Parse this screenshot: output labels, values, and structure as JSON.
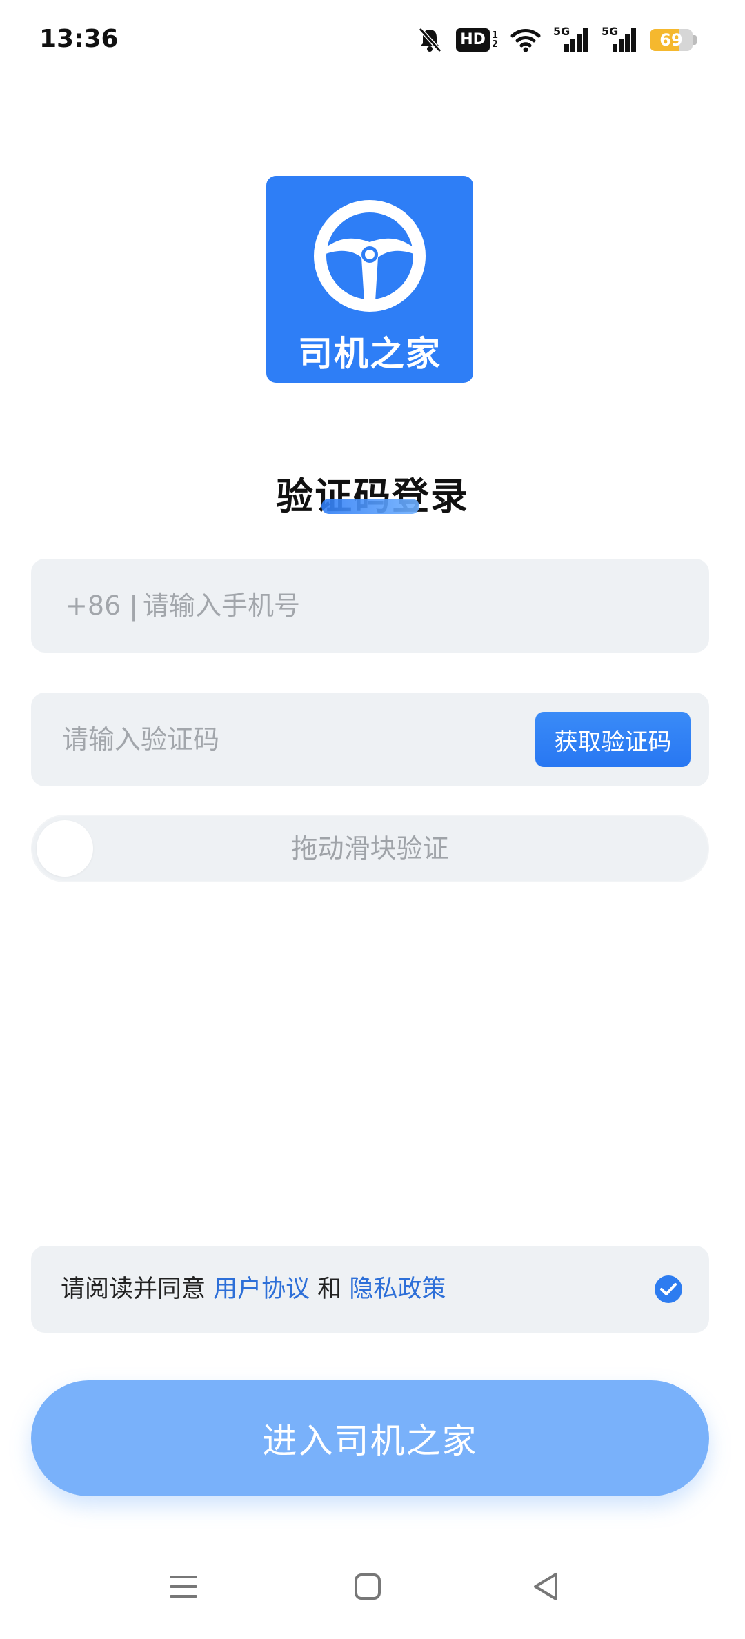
{
  "status_bar": {
    "time": "13:36",
    "hd_label": "HD",
    "hd_sub_1": "1",
    "hd_sub_2": "2",
    "signal_1_label": "5G",
    "signal_2_label": "5G",
    "battery_level": "69",
    "battery_fraction": 0.69,
    "battery_color": "#f5b82e",
    "icons": [
      "bell-muted-icon",
      "hd-icon",
      "wifi-icon",
      "signal-icon",
      "signal-icon",
      "battery-icon"
    ]
  },
  "app": {
    "logo_icon": "steering-wheel-icon",
    "logo_text": "司机之家",
    "brand_color": "#2e7ef6"
  },
  "login": {
    "title": "验证码登录",
    "phone": {
      "country_code": "+86 |",
      "placeholder": "请输入手机号"
    },
    "code": {
      "placeholder": "请输入验证码",
      "get_code_label": "获取验证码"
    },
    "slider": {
      "label": "拖动滑块验证"
    },
    "agreement": {
      "prefix": "请阅读并同意 ",
      "user_agreement": "用户协议",
      "conjunction": " 和 ",
      "privacy_policy": "隐私政策",
      "checked": true
    },
    "submit_label": "进入司机之家",
    "submit_color": "#79b1fa"
  },
  "nav_bar": {
    "icons": [
      "menu-icon",
      "home-icon",
      "back-icon"
    ]
  }
}
